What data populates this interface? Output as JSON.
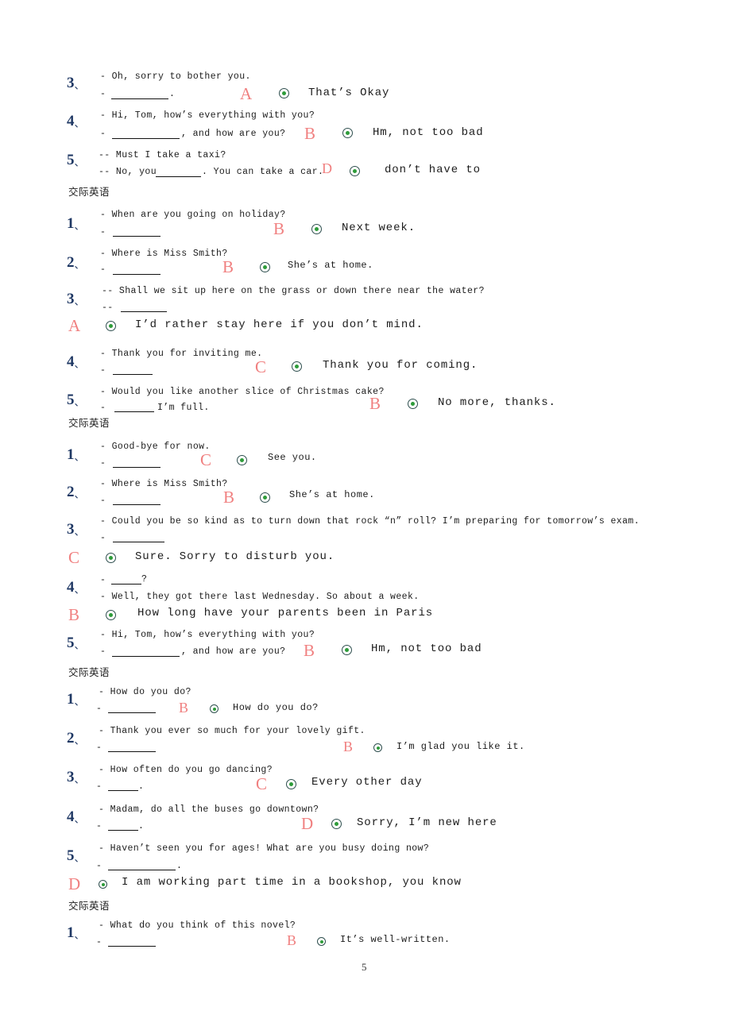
{
  "document": {
    "page_number": "5",
    "section_heading": "交际英语",
    "enumeration_mark": "、",
    "colors": {
      "question_number": "#1f3864",
      "answer_letter": "#f08080",
      "radio_dot": "#2e9c3a",
      "radio_ring": "#2f4f4f",
      "text": "#1c1c1c",
      "background": "#ffffff"
    }
  },
  "blocks": [
    {
      "heading": null,
      "items": [
        {
          "number": "3",
          "prompt": "- Oh, sorry to bother you.",
          "reply_prefix": "-",
          "reply_suffix": ".",
          "letter": "A",
          "answer": "That’s Okay",
          "layout": "inline"
        },
        {
          "number": "4",
          "prompt": "- Hi, Tom, how’s everything with you?",
          "reply_prefix": "-",
          "reply_suffix": ", and how are you?",
          "letter": "B",
          "answer": "Hm, not too bad",
          "layout": "inline"
        },
        {
          "number": "5",
          "prompt": "-- Must I take a taxi?",
          "reply_prefix": "-- No, you",
          "reply_suffix": ". You can take a car.",
          "letter": "D",
          "answer": "don’t have to",
          "layout": "inline"
        }
      ]
    },
    {
      "heading": "交际英语",
      "items": [
        {
          "number": "1",
          "prompt": "- When are you going on holiday?",
          "reply_prefix": "-",
          "reply_suffix": "",
          "letter": "B",
          "answer": "Next week.",
          "layout": "inline"
        },
        {
          "number": "2",
          "prompt": "- Where is Miss Smith?",
          "reply_prefix": "-",
          "reply_suffix": "",
          "letter": "B",
          "answer": "She’s at home.",
          "layout": "inline"
        },
        {
          "number": "3",
          "prompt": "-- Shall we sit up here on the grass or down there near the water?",
          "reply_prefix": "--",
          "reply_suffix": "",
          "letter": "A",
          "answer": "I’d rather stay here if you don’t mind.",
          "layout": "below"
        },
        {
          "number": "4",
          "prompt": "- Thank you for inviting me.",
          "reply_prefix": "-",
          "reply_suffix": "",
          "letter": "C",
          "answer": "Thank you for coming.",
          "layout": "inline"
        },
        {
          "number": "5",
          "prompt": "- Would you like another slice of Christmas cake?",
          "reply_prefix": "-",
          "reply_suffix": "I’m full.",
          "letter": "B",
          "answer": "No more, thanks.",
          "layout": "inline"
        }
      ]
    },
    {
      "heading": "交际英语",
      "items": [
        {
          "number": "1",
          "prompt": "- Good-bye for now.",
          "reply_prefix": "-",
          "reply_suffix": "",
          "letter": "C",
          "answer": "See you.",
          "layout": "inline"
        },
        {
          "number": "2",
          "prompt": "- Where is Miss Smith?",
          "reply_prefix": "-",
          "reply_suffix": "",
          "letter": "B",
          "answer": "She’s at home.",
          "layout": "inline"
        },
        {
          "number": "3",
          "prompt": "- Could you be so kind as to turn down that rock “n” roll? I’m preparing for tomorrow’s exam.",
          "reply_prefix": "-",
          "reply_suffix": "",
          "letter": "C",
          "answer": "Sure. Sorry to disturb you.",
          "layout": "below"
        },
        {
          "number": "4",
          "prompt": "- Well, they got there last Wednesday. So about a week.",
          "reply_prefix": "-",
          "reply_suffix": "?",
          "letter": "B",
          "answer": "How long have your parents been in Paris",
          "layout": "below-reversed"
        },
        {
          "number": "5",
          "prompt": "- Hi, Tom, how’s everything with you?",
          "reply_prefix": "-",
          "reply_suffix": ", and how are you?",
          "letter": "B",
          "answer": "Hm, not too bad",
          "layout": "inline"
        }
      ]
    },
    {
      "heading": "交际英语",
      "items": [
        {
          "number": "1",
          "prompt": "- How do you do?",
          "reply_prefix": "-",
          "reply_suffix": "",
          "letter": "B",
          "answer": "How do you do?",
          "layout": "inline"
        },
        {
          "number": "2",
          "prompt": "- Thank you ever so much for your lovely gift.",
          "reply_prefix": "-",
          "reply_suffix": "",
          "letter": "B",
          "answer": "I’m glad you like it.",
          "layout": "inline"
        },
        {
          "number": "3",
          "prompt": "- How often do you go dancing?",
          "reply_prefix": "-",
          "reply_suffix": ".",
          "letter": "C",
          "answer": "Every other day",
          "layout": "inline"
        },
        {
          "number": "4",
          "prompt": "- Madam, do all the buses go downtown?",
          "reply_prefix": "-",
          "reply_suffix": ".",
          "letter": "D",
          "answer": "Sorry, I’m new here",
          "layout": "inline"
        },
        {
          "number": "5",
          "prompt": "- Haven’t seen you for ages! What are you busy doing now?",
          "reply_prefix": "-",
          "reply_suffix": ".",
          "letter": "D",
          "answer": "I am working part time in a bookshop, you know",
          "layout": "below"
        }
      ]
    },
    {
      "heading": "交际英语",
      "items": [
        {
          "number": "1",
          "prompt": "- What do you think of this novel?",
          "reply_prefix": "-",
          "reply_suffix": "",
          "letter": "B",
          "answer": "It’s well-written.",
          "layout": "inline"
        }
      ]
    }
  ],
  "lines": {
    "b1q3_num": "3",
    "b1q3_prompt": "- Oh, sorry to bother you.",
    "b1q3_dash": "-",
    "b1q3_dot": ".",
    "b1q3_letter": "A",
    "b1q3_answer": "That’s Okay",
    "b1q4_num": "4",
    "b1q4_prompt": "- Hi, Tom, how’s everything with you?",
    "b1q4_dash": "-",
    "b1q4_tail": ", and how are you?",
    "b1q4_letter": "B",
    "b1q4_answer": "Hm, not too bad",
    "b1q5_num": "5",
    "b1q5_prompt": "-- Must I take a taxi?",
    "b1q5_head": "-- No, you",
    "b1q5_tail": ". You can take a car.",
    "b1q5_letter": "D",
    "b1q5_answer": "don’t have to",
    "h1": "交际英语",
    "b2q1_num": "1",
    "b2q1_prompt": "- When are you going on holiday?",
    "b2q1_dash": "-",
    "b2q1_letter": "B",
    "b2q1_answer": "Next week.",
    "b2q2_num": "2",
    "b2q2_prompt": "- Where is Miss Smith?",
    "b2q2_dash": "-",
    "b2q2_letter": "B",
    "b2q2_answer": "She’s at home.",
    "b2q3_num": "3",
    "b2q3_prompt": "-- Shall we sit up here on the grass or down there near the water?",
    "b2q3_dash": "--",
    "b2q3_letter": "A",
    "b2q3_answer": "I’d rather stay here if you don’t mind.",
    "b2q4_num": "4",
    "b2q4_prompt": "- Thank you for inviting me.",
    "b2q4_dash": "-",
    "b2q4_letter": "C",
    "b2q4_answer": "Thank you for coming.",
    "b2q5_num": "5",
    "b2q5_prompt": "- Would you like another slice of Christmas cake?",
    "b2q5_dash": "-",
    "b2q5_tail": "I’m full.",
    "b2q5_letter": "B",
    "b2q5_answer": "No more, thanks.",
    "h2": "交际英语",
    "b3q1_num": "1",
    "b3q1_prompt": "- Good-bye for now.",
    "b3q1_dash": "-",
    "b3q1_letter": "C",
    "b3q1_answer": "See you.",
    "b3q2_num": "2",
    "b3q2_prompt": "- Where is Miss Smith?",
    "b3q2_dash": "-",
    "b3q2_letter": "B",
    "b3q2_answer": "She’s at home.",
    "b3q3_num": "3",
    "b3q3_prompt": "- Could you be so kind as to turn down that rock “n” roll? I’m preparing for tomorrow’s exam.",
    "b3q3_dash": "-",
    "b3q3_letter": "C",
    "b3q3_answer": "Sure. Sorry to disturb you.",
    "b3q4_num": "4",
    "b3q4_dash": "-",
    "b3q4_q": "?",
    "b3q4_prompt": "- Well, they got there last Wednesday. So about a week.",
    "b3q4_letter": "B",
    "b3q4_answer": "How long have your parents been in Paris",
    "b3q5_num": "5",
    "b3q5_prompt": "- Hi, Tom, how’s everything with you?",
    "b3q5_dash": "-",
    "b3q5_tail": ", and how are you?",
    "b3q5_letter": "B",
    "b3q5_answer": "Hm, not too bad",
    "h3": "交际英语",
    "b4q1_num": "1",
    "b4q1_prompt": "- How do you do?",
    "b4q1_dash": "-",
    "b4q1_letter": "B",
    "b4q1_answer": "How do you do?",
    "b4q2_num": "2",
    "b4q2_prompt": "- Thank you ever so much for your lovely gift.",
    "b4q2_dash": "-",
    "b4q2_letter": "B",
    "b4q2_answer": "I’m glad you like it.",
    "b4q3_num": "3",
    "b4q3_prompt": "- How often do you go dancing?",
    "b4q3_dash": "-",
    "b4q3_dot": ".",
    "b4q3_letter": "C",
    "b4q3_answer": "Every other day",
    "b4q4_num": "4",
    "b4q4_prompt": "- Madam, do all the buses go downtown?",
    "b4q4_dash": "-",
    "b4q4_dot": ".",
    "b4q4_letter": "D",
    "b4q4_answer": "Sorry, I’m new here",
    "b4q5_num": "5",
    "b4q5_prompt": "- Haven’t seen you for ages! What are you busy doing now?",
    "b4q5_dash": "-",
    "b4q5_dot": ".",
    "b4q5_letter": "D",
    "b4q5_answer": "I am working part time in a bookshop, you know",
    "h4": "交际英语",
    "b5q1_num": "1",
    "b5q1_prompt": "- What do you think of this novel?",
    "b5q1_dash": "-",
    "b5q1_letter": "B",
    "b5q1_answer": "It’s well-written.",
    "page_number": "5",
    "dun": "、"
  }
}
